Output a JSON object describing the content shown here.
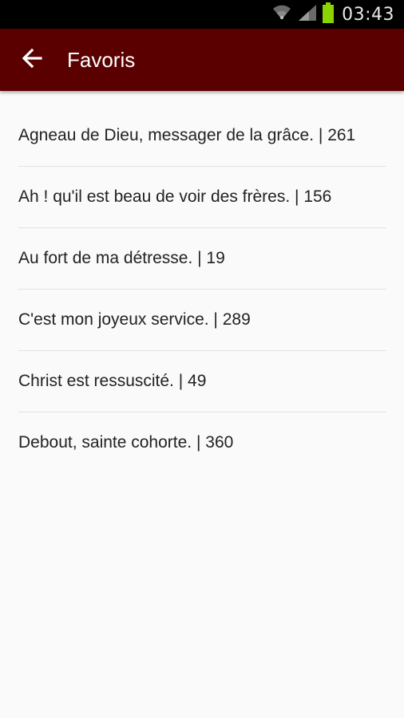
{
  "status_bar": {
    "time": "03:43",
    "icons": [
      "wifi-icon",
      "signal-icon",
      "battery-icon"
    ],
    "battery_color": "#8bd400"
  },
  "app_bar": {
    "title": "Favoris",
    "back_icon": "arrow-left-icon",
    "background_color": "#5a0000"
  },
  "favorites": [
    {
      "label": "Agneau de Dieu, messager de la grâce. | 261"
    },
    {
      "label": "Ah ! qu'il est beau de voir des frères. | 156"
    },
    {
      "label": "Au fort de ma détresse. | 19"
    },
    {
      "label": "C'est mon joyeux service. | 289"
    },
    {
      "label": "Christ est ressuscité. | 49"
    },
    {
      "label": "Debout, sainte cohorte. | 360"
    }
  ]
}
